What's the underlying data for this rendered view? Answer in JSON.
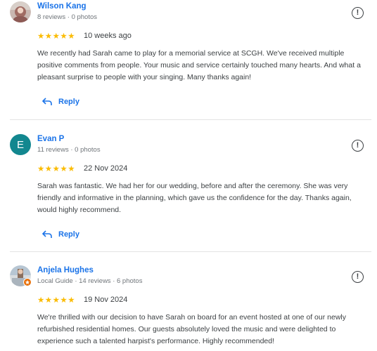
{
  "reviews": [
    {
      "name": "Wilson Kang",
      "meta": "8 reviews · 0 photos",
      "stars": "★★★★★",
      "date": "10 weeks ago",
      "text": "We recently had Sarah came to play for a memorial service at SCGH. We've received multiple positive comments from people. Your music and service certainly touched many hearts. And what a pleasant surprise to people with your singing. Many thanks again!",
      "reply_label": "Reply"
    },
    {
      "name": "Evan P",
      "initial": "E",
      "meta": "11 reviews · 0 photos",
      "stars": "★★★★★",
      "date": "22 Nov 2024",
      "text": "Sarah was fantastic. We had her for our wedding, before and after the ceremony. She was very friendly and informative in the planning, which gave us the confidence for the day. Thanks again, would highly recommend.",
      "reply_label": "Reply"
    },
    {
      "name": "Anjela Hughes",
      "meta": "Local Guide · 14 reviews · 6 photos",
      "stars": "★★★★★",
      "date": "19 Nov 2024",
      "text": "We're thrilled with our decision to have Sarah on board for an event hosted at one of our newly refurbished residential homes. Our guests absolutely loved the music and were delighted to experience such a talented harpist's performance. Highly recommended!"
    }
  ],
  "icons": {
    "more": "!",
    "reply_icon": "reply-arrow-icon"
  },
  "colors": {
    "link": "#1a73e8",
    "star": "#fbbc04",
    "avatar_e": "#12878f",
    "local_guide_badge": "#e8710a"
  }
}
